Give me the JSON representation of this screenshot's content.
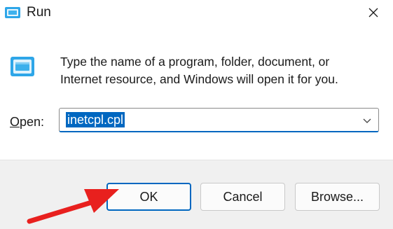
{
  "window": {
    "title": "Run",
    "close_glyph": "✕",
    "icon": "run-icon"
  },
  "dialog": {
    "description_line1": "Type the name of a program, folder, document, or",
    "description_line2": "Internet resource, and Windows will open it for you.",
    "open_label_accel": "O",
    "open_label_rest": "pen:",
    "open_value": "inetcpl.cpl"
  },
  "buttons": {
    "ok_label": "OK",
    "cancel_label": "Cancel",
    "browse_label": "Browse..."
  },
  "colors": {
    "accent": "#0067c0",
    "arrow": "#e8201e",
    "footer_bg": "#f0f0f0"
  }
}
